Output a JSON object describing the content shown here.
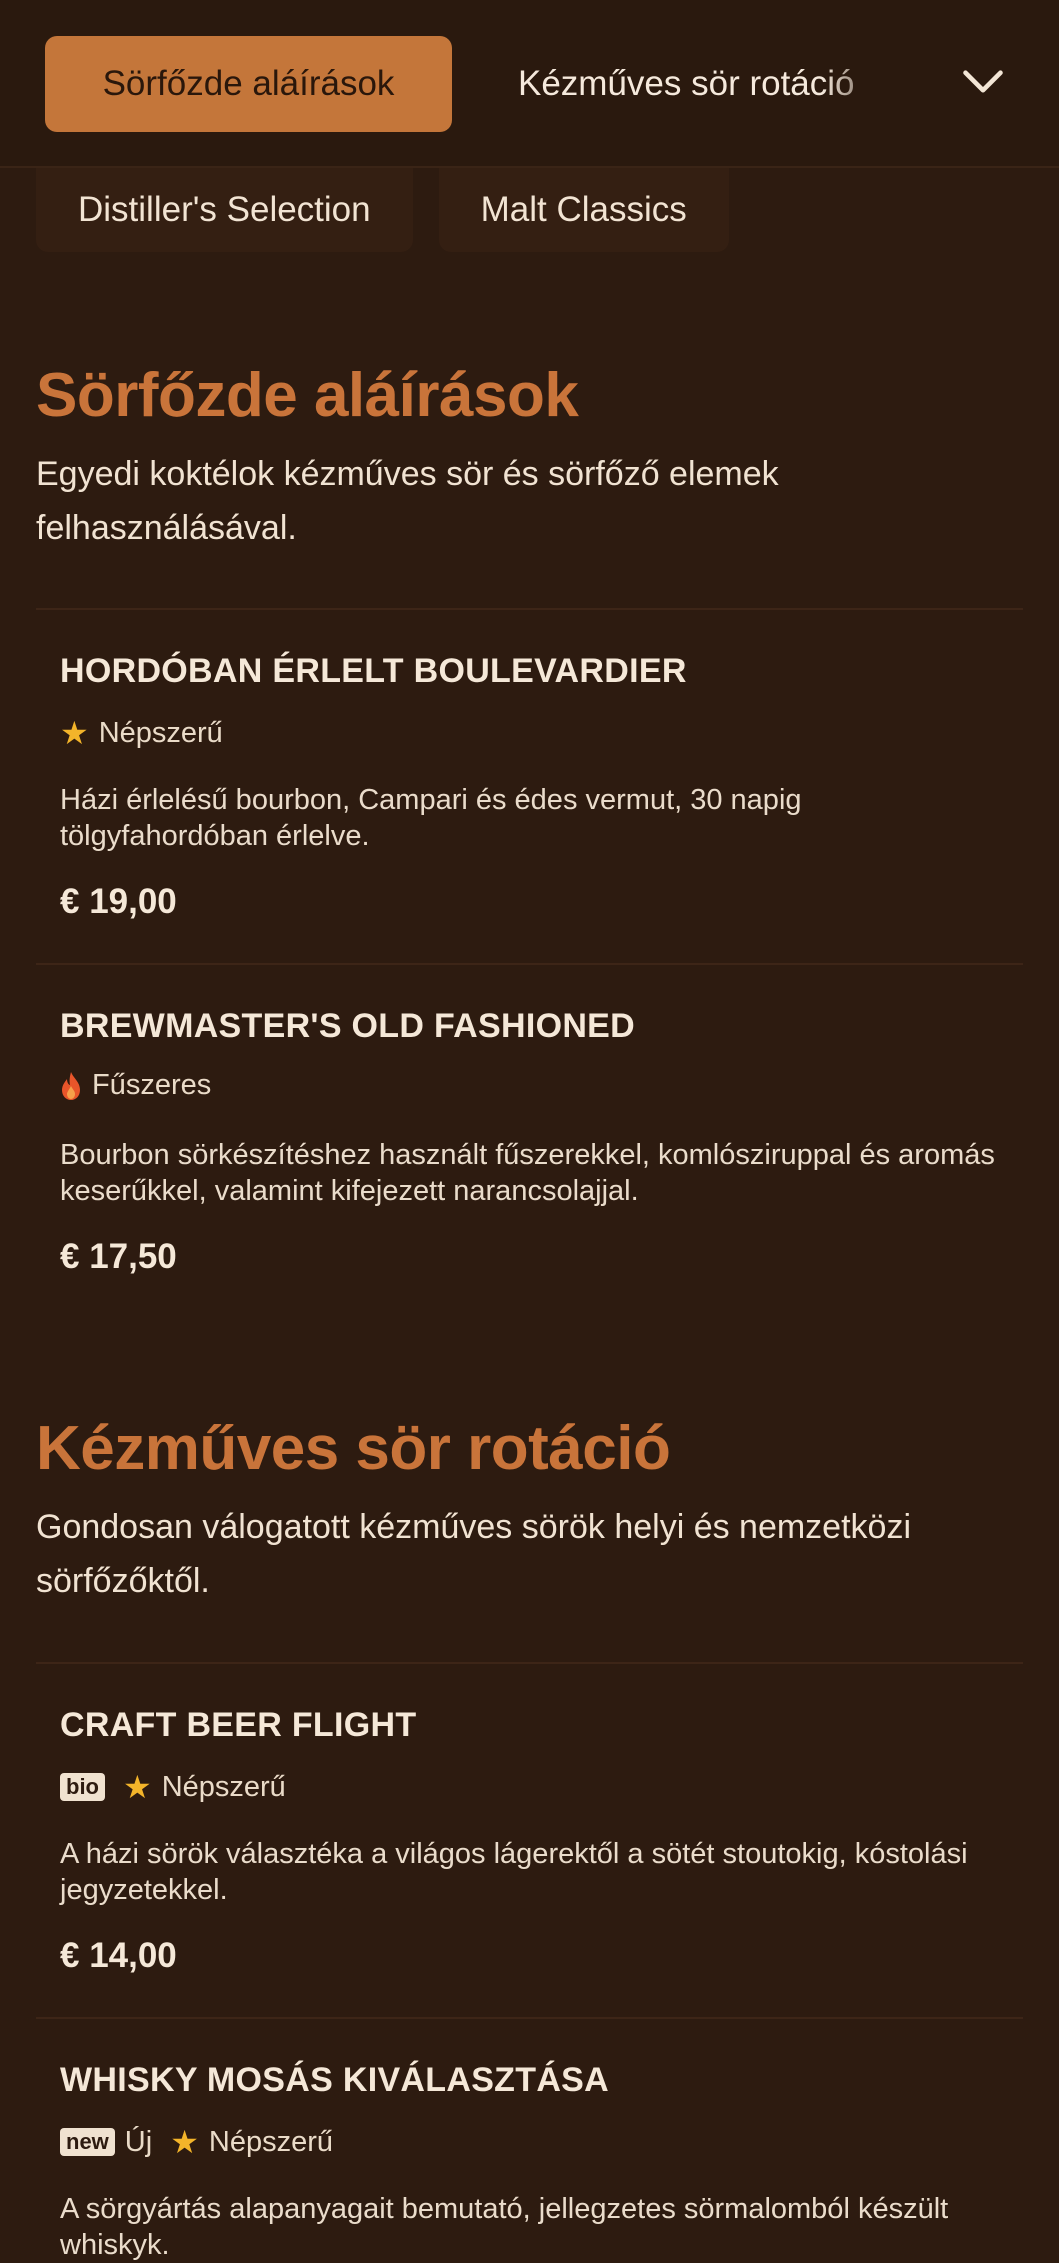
{
  "nav": {
    "tabs": [
      "Sörfőzde aláírások",
      "Kézműves sör rotáció",
      "Distiller's Selection",
      "Malt Classics"
    ]
  },
  "sections": [
    {
      "title": "Sörfőzde aláírások",
      "description": "Egyedi koktélok kézműves sör és sörfőző elemek felhasználásával.",
      "items": [
        {
          "name": "HORDÓBAN ÉRLELT BOULEVARDIER",
          "tag_icon": "star-icon",
          "tag": "Népszerű",
          "description": "Házi érlelésű bourbon, Campari és édes vermut, 30 napig tölgyfahordóban érlelve.",
          "price": "€ 19,00"
        },
        {
          "name": "BREWMASTER'S OLD FASHIONED",
          "tag_icon": "flame-icon",
          "tag": "Fűszeres",
          "description": "Bourbon sörkészítéshez használt fűszerekkel, komlósziruppal és aromás keserűkkel, valamint kifejezett narancsolajjal.",
          "price": "€ 17,50"
        }
      ]
    },
    {
      "title": "Kézműves sör rotáció",
      "description": "Gondosan válogatott kézműves sörök helyi és nemzetközi sörfőzőktől.",
      "items": [
        {
          "name": "CRAFT BEER FLIGHT",
          "badge": "bio",
          "tag_icon": "star-icon",
          "tag": "Népszerű",
          "description": "A házi sörök választéka a világos lágerektől a sötét stoutokig, kóstolási jegyzetekkel.",
          "price": "€ 14,00"
        },
        {
          "name": "WHISKY MOSÁS KIVÁLASZTÁSA",
          "badge": "new",
          "badge_text": "Új",
          "tag_icon": "star-icon",
          "tag": "Népszerű",
          "description": "A sörgyártás alapanyagait bemutató, jellegzetes sörmalomból készült whiskyk."
        }
      ]
    }
  ],
  "colors": {
    "background": "#2d1b10",
    "accent": "#c4763a",
    "heading": "#c9743a",
    "star": "#f3b42a",
    "flame": "#e8552a"
  }
}
